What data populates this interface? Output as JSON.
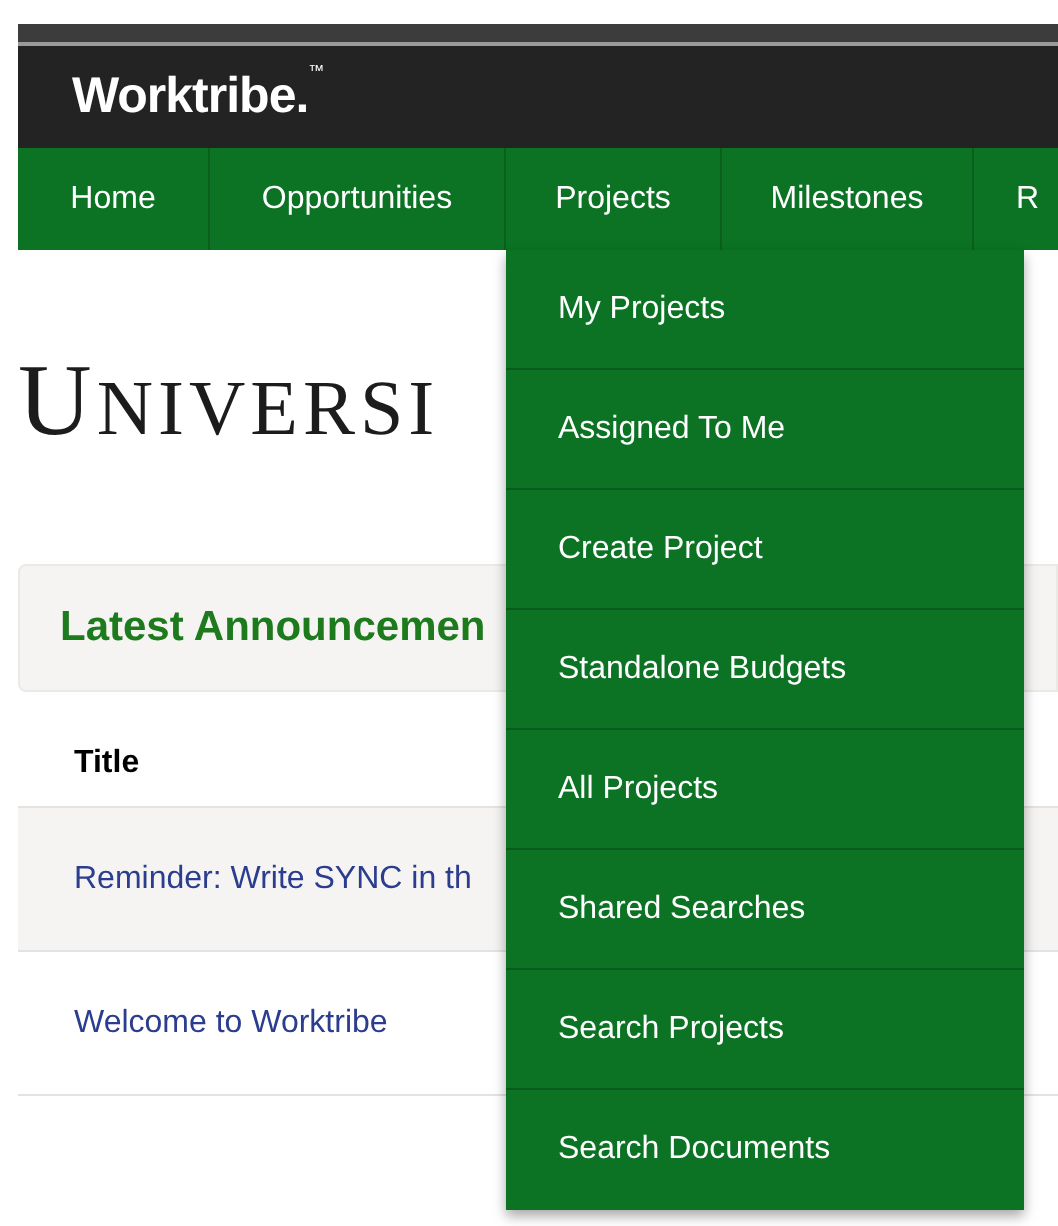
{
  "header": {
    "logo": "Worktribe.$^{™}$"
  },
  "nav": [
    "Home",
    "Opportunities",
    "Projects",
    "Milestones",
    "R"
  ],
  "dropdown": [
    "My Projects",
    "Assigned To Me",
    "Create Project",
    "Standalone Budgets",
    "All Projects",
    "Shared Searches",
    "Search Projects",
    "Search Documents"
  ],
  "banner": {
    "text": "UNIVERSI"
  },
  "announcements": {
    "title": "Latest Announcemen",
    "columns": [
      "Title"
    ],
    "rows": [
      "Reminder: Write SYNC in th",
      "Welcome to Worktribe"
    ]
  }
}
